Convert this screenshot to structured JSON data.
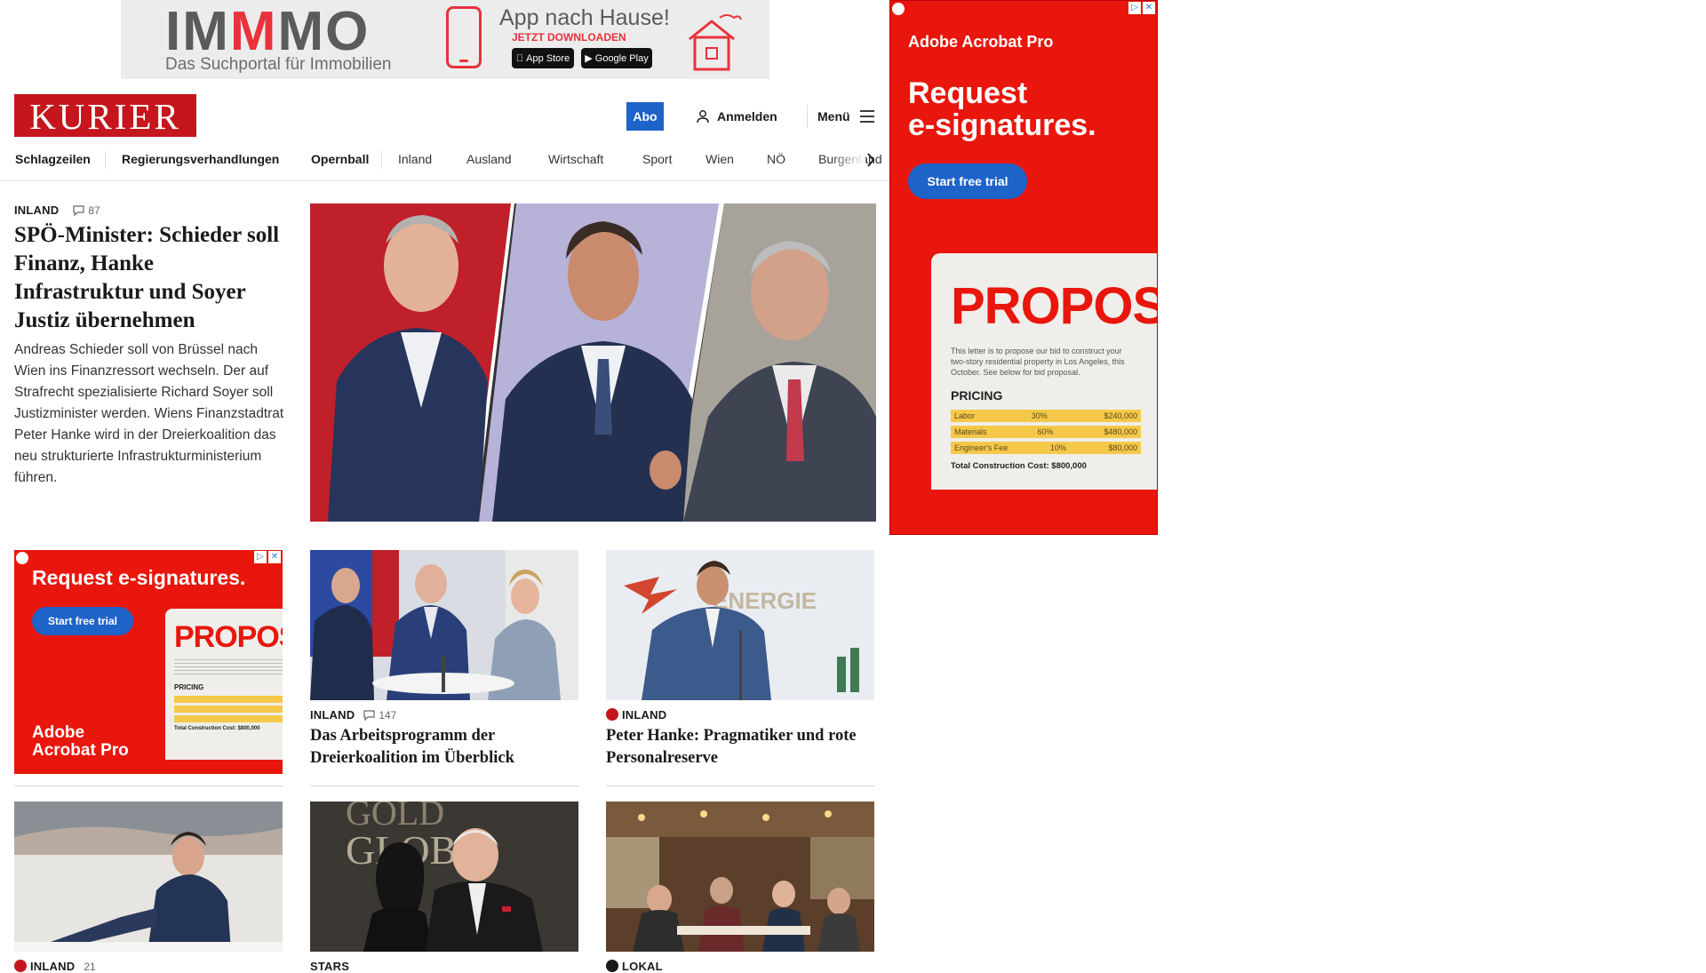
{
  "top_ad": {
    "logo_part1": "IM",
    "logo_red": "M",
    "logo_part2": "MO",
    "tagline": "Das Suchportal für Immobilien",
    "headline": "App nach Hause!",
    "sub": "JETZT DOWNLOADEN",
    "apple_badge": "App Store",
    "google_badge": "Google Play"
  },
  "header": {
    "logo": "KURIER",
    "abo": "Abo",
    "login": "Anmelden",
    "menu": "Menü"
  },
  "nav": {
    "items": [
      "Schlagzeilen",
      "Regierungsverhandlungen",
      "Opernball",
      "Inland",
      "Ausland",
      "Wirtschaft",
      "Sport",
      "Wien",
      "NÖ",
      "Burgenland"
    ]
  },
  "lead": {
    "rubric": "INLAND",
    "comments": "87",
    "title": "SPÖ-Minister: Schieder soll Finanz, Hanke Infrastruktur und Soyer Justiz übernehmen",
    "teaser": "Andreas Schieder soll von Brüssel nach Wien ins Finanzressort wechseln. Der auf Strafrecht spezialisierte Richard Soyer soll Justizminister werden. Wiens Finanzstadtrat Peter Hanke wird in der Dreierkoalition das neu strukturierte Infrastrukturministerium führen."
  },
  "sky_ad": {
    "brand": "Adobe Acrobat Pro",
    "headline_line1": "Request",
    "headline_line2": "e-signatures.",
    "cta": "Start free trial",
    "doc": {
      "title": "PROPOSAL",
      "intro": "This letter is to propose our bid to construct your two-story residential property in Los Angeles, this October. See below for bid proposal.",
      "pricing_label": "PRICING",
      "rows": [
        {
          "item": "Labor",
          "pct": "30%",
          "amount": "$240,000"
        },
        {
          "item": "Materials",
          "pct": "60%",
          "amount": "$480,000"
        },
        {
          "item": "Engineer's Fee",
          "pct": "10%",
          "amount": "$80,000"
        }
      ],
      "total": "Total Construction Cost: $800,000"
    }
  },
  "inline_ad": {
    "headline": "Request e-signatures.",
    "cta": "Start free trial",
    "brand_line1": "Adobe",
    "brand_line2": "Acrobat Pro",
    "doc_title": "PROPOSAL",
    "pricing_label": "PRICING",
    "total": "Total Construction Cost: $800,000"
  },
  "cards": [
    {
      "rubric": "INLAND",
      "comments": "147",
      "title": "Das Arbeitsprogramm der Dreierkoalition im Überblick",
      "premium": false
    },
    {
      "rubric": "INLAND",
      "comments": "",
      "title": "Peter Hanke: Pragmatiker und rote Personalreserve",
      "premium": true
    },
    {
      "rubric": "INLAND",
      "comments": "21",
      "premium": true
    },
    {
      "rubric": "STARS",
      "premium": false
    },
    {
      "rubric": "LOKAL",
      "premium": true
    }
  ],
  "photo_text": {
    "energie": "ENERGIE",
    "golden": "GOLD",
    "globe": "GLOB"
  },
  "colors": {
    "brand_red": "#c4161c",
    "abo_blue": "#1e63c8",
    "ad_red": "#e8160c"
  }
}
